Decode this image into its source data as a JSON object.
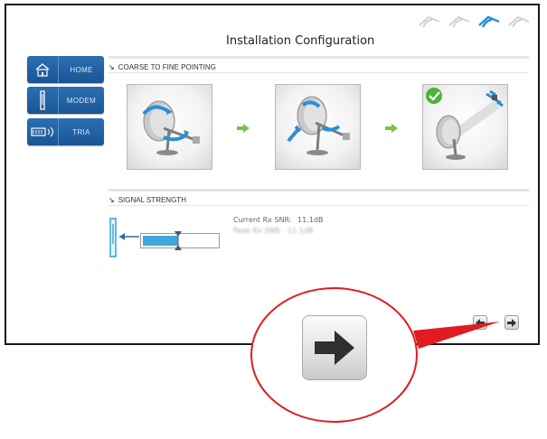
{
  "page": {
    "title": "Installation Configuration"
  },
  "wizard": {
    "steps": 4,
    "active_step": 3
  },
  "sidebar": {
    "items": [
      {
        "label": "HOME",
        "icon": "home-icon"
      },
      {
        "label": "MODEM",
        "icon": "modem-icon"
      },
      {
        "label": "TRIA",
        "icon": "tria-icon"
      }
    ]
  },
  "pointing": {
    "heading": "COARSE TO FINE POINTING",
    "steps": [
      {
        "icon": "dish-coarse-adjust-icon"
      },
      {
        "icon": "dish-fine-adjust-icon"
      },
      {
        "icon": "dish-aligned-satellite-icon"
      }
    ]
  },
  "signal": {
    "heading": "SIGNAL STRENGTH",
    "snr_label": "Current Rx SNR:",
    "snr_value": "11.1dB",
    "snr_blurred_label": "Peak Rx SNR:",
    "snr_blurred_value": "11.1dB",
    "level_fraction": 0.47
  },
  "navigation": {
    "back_icon": "arrow-left-icon",
    "next_icon": "arrow-right-icon"
  },
  "colors": {
    "accent": "#2b6fb4",
    "meter": "#41a8dd",
    "highlight": "#e11b22",
    "step_arrow": "#7cc142"
  }
}
